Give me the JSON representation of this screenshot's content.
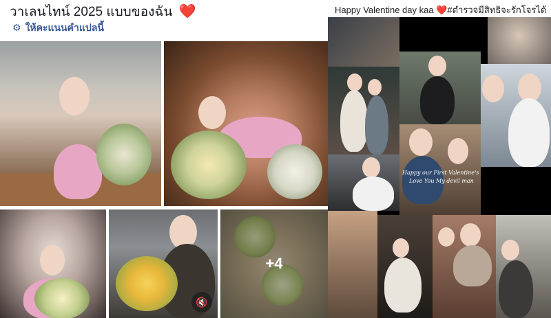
{
  "left_post": {
    "title": "วาเลนไทน์ 2025 แบบของฉัน",
    "title_emoji": "❤️",
    "translate_label": "ให้คะแนนคำแปลนี้",
    "more_photos_label": "+4",
    "mute_icon": "speaker-muted-icon"
  },
  "right_post": {
    "caption": "Happy Valentine day kaa",
    "caption_hashtag": "#ตำรวจมีสิทธิจะรักโจรได้",
    "caption_emoji": "❤️",
    "overlay_line1": "Happy our First Valentine's Day",
    "overlay_line2": "Love You My devil man"
  },
  "colors": {
    "heart": "#e0245e",
    "link": "#385898",
    "text": "#1c1e21"
  }
}
